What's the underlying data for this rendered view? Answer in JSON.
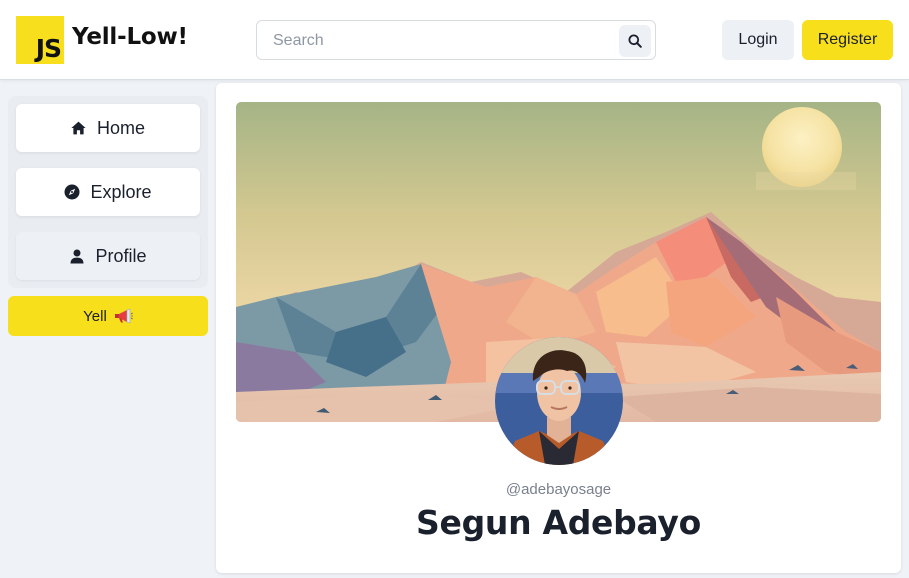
{
  "header": {
    "logo_text": "JS",
    "brand": "Yell-Low!",
    "search": {
      "placeholder": "Search",
      "value": ""
    },
    "login_label": "Login",
    "register_label": "Register"
  },
  "sidebar": {
    "items": [
      {
        "label": "Home",
        "icon": "home-icon"
      },
      {
        "label": "Explore",
        "icon": "compass-icon"
      },
      {
        "label": "Profile",
        "icon": "user-icon"
      }
    ],
    "active_item": "Profile",
    "yell_label": "Yell",
    "yell_icon": "megaphone-icon"
  },
  "profile": {
    "handle": "@adebayosage",
    "name": "Segun Adebayo"
  },
  "colors": {
    "accent": "#f8df1c",
    "background": "#eff2f7",
    "button_secondary": "#edf1f5",
    "text": "#1a202c"
  }
}
